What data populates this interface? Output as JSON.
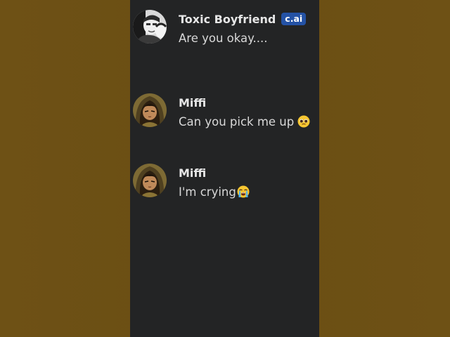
{
  "messages": [
    {
      "sender": "Toxic Boyfriend",
      "badge": "c.ai",
      "text": "Are you okay....",
      "avatar_icon": "bw-photo-avatar-icon"
    },
    {
      "sender": "Miffi",
      "text": "Can you pick me up",
      "emoji": "pleading-face-icon",
      "avatar_icon": "anime-girl-avatar-icon"
    },
    {
      "sender": "Miffi",
      "text": "I'm crying",
      "emoji": "loudly-crying-face-icon",
      "avatar_icon": "anime-girl-avatar-icon"
    }
  ],
  "colors": {
    "background": "#6b4f16",
    "panel": "#232425",
    "badge": "#2452a5",
    "name": "#e6e6e6",
    "text": "#d8d8d8"
  }
}
